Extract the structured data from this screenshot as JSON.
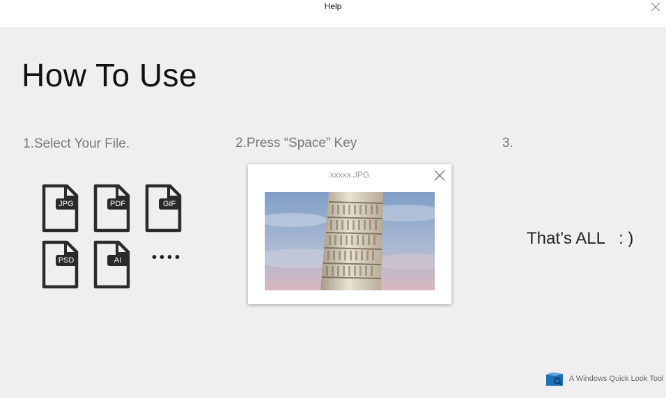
{
  "window": {
    "title": "Help"
  },
  "main": {
    "heading": "How To Use",
    "steps": [
      {
        "label": "1.Select Your File."
      },
      {
        "label": "2.Press “Space” Key"
      },
      {
        "label": "3."
      }
    ],
    "file_types": [
      "JPG",
      "PDF",
      "GIF",
      "PSD",
      "AI"
    ],
    "more": "••••",
    "preview": {
      "filename": "xxxxx.JPG"
    },
    "done_text": "That’s ALL   : )",
    "brand": {
      "text": "A Windows Quick Look Tool",
      "accent": "#1e6fb5"
    }
  }
}
